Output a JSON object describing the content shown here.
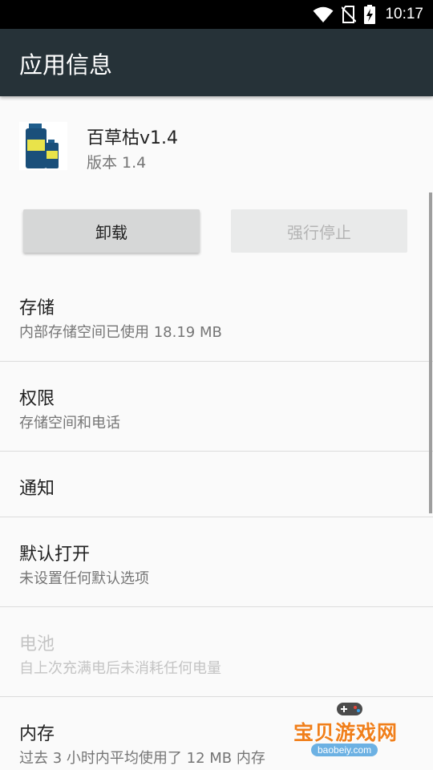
{
  "status_bar": {
    "time": "10:17"
  },
  "app_bar": {
    "title": "应用信息"
  },
  "app": {
    "name": "百草枯v1.4",
    "version": "版本 1.4"
  },
  "buttons": {
    "uninstall": "卸载",
    "force_stop": "强行停止"
  },
  "sections": [
    {
      "title": "存储",
      "subtitle": "内部存储空间已使用 18.19 MB"
    },
    {
      "title": "权限",
      "subtitle": "存储空间和电话"
    },
    {
      "title": "通知"
    },
    {
      "title": "默认打开",
      "subtitle": "未设置任何默认选项"
    },
    {
      "title": "电池",
      "subtitle": "自上次充满电后未消耗任何电量"
    },
    {
      "title": "内存",
      "subtitle": "过去 3 小时内平均使用了 12 MB 内存"
    }
  ],
  "watermark": {
    "text": "宝贝游戏网",
    "domain": "baobeiy.com"
  },
  "colors": {
    "app_bar": "#263238",
    "status_bar": "#000000",
    "background": "#fafafa"
  }
}
